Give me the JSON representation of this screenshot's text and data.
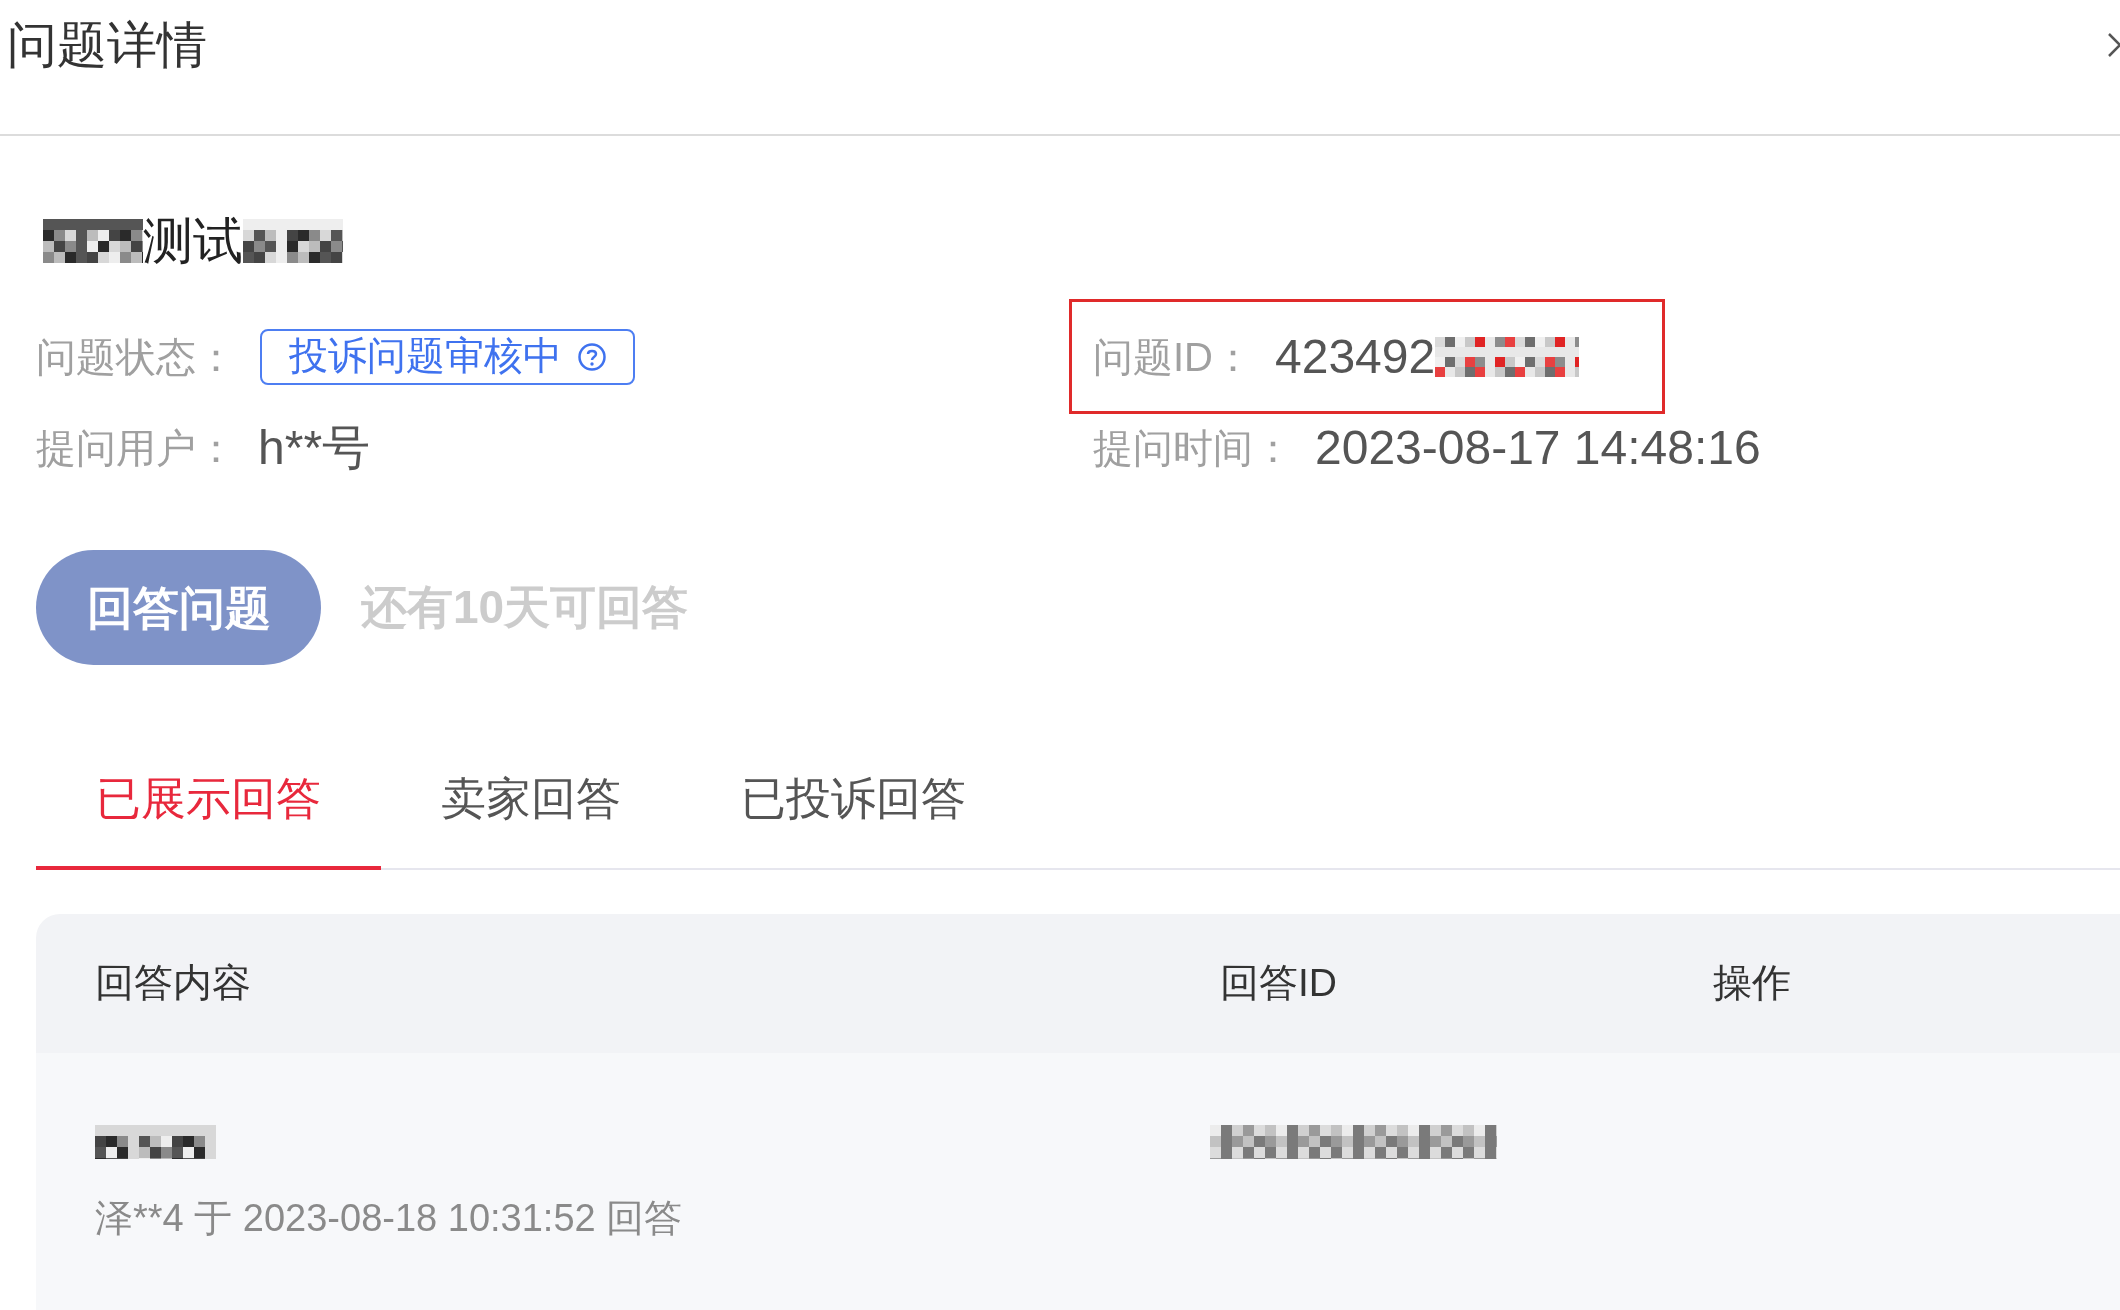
{
  "dialog": {
    "title": "问题详情"
  },
  "question": {
    "title": "测试",
    "fields": [
      {
        "kind": "status",
        "label": "问题状态：",
        "value": "投诉问题审核中",
        "highlighted": false
      },
      {
        "kind": "id",
        "label": "问题ID：",
        "value": "423492",
        "highlighted": true
      },
      {
        "kind": "text",
        "label": "提问用户：",
        "value": "h**号",
        "highlighted": false
      },
      {
        "kind": "text",
        "label": "提问时间：",
        "value": "2023-08-17 14:48:16",
        "highlighted": false
      }
    ]
  },
  "answer_button": {
    "label": "回答问题",
    "disabled": true
  },
  "answer_deadline": "还有10天可回答",
  "tabs": [
    {
      "label": "已展示回答",
      "selected": true
    },
    {
      "label": "卖家回答",
      "selected": false
    },
    {
      "label": "已投诉回答",
      "selected": false
    }
  ],
  "table": {
    "columns": [
      "回答内容",
      "回答ID",
      "操作"
    ],
    "rows": [
      {
        "meta": "泽**4 于 2023-08-18 10:31:52 回答"
      }
    ]
  }
}
